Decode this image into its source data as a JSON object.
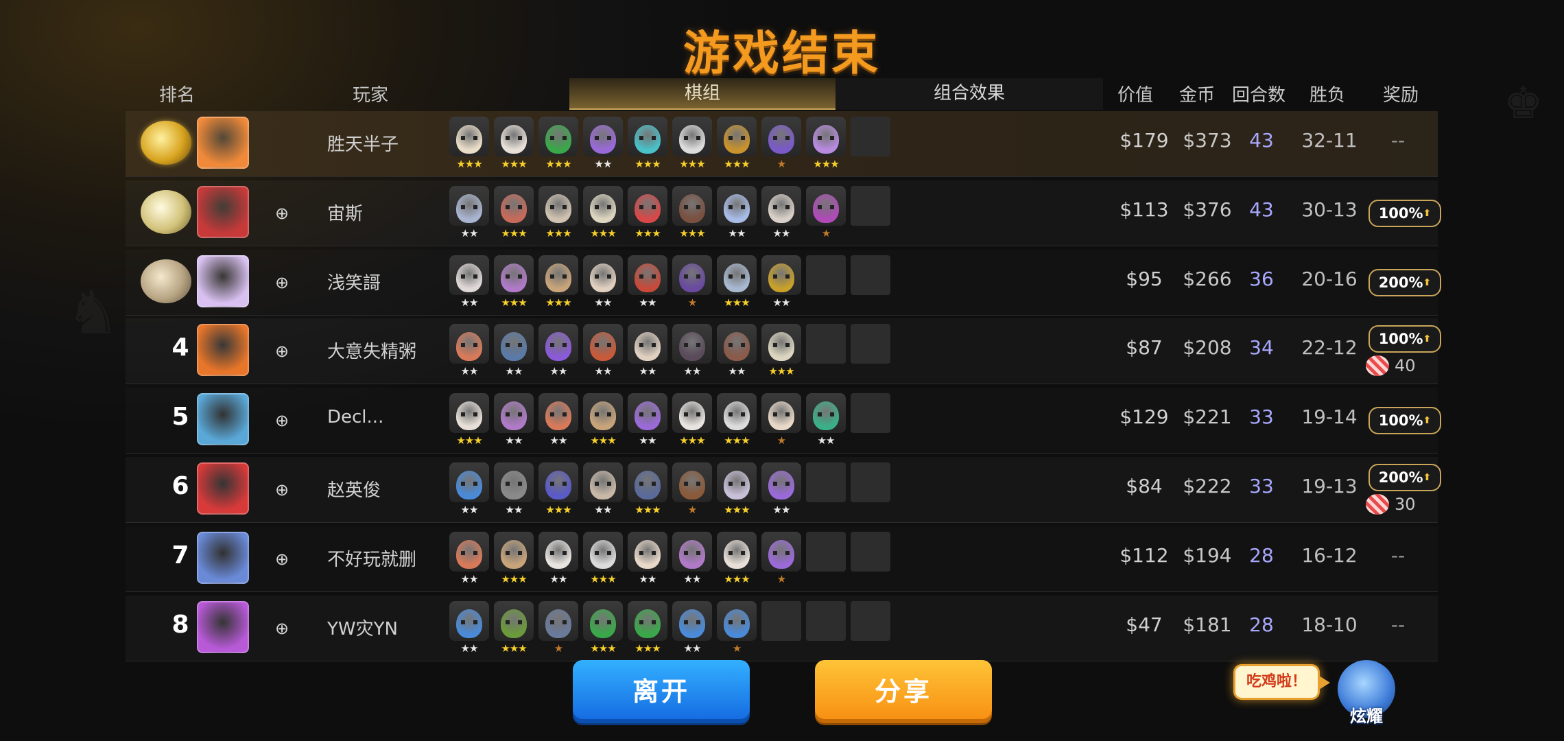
{
  "title": "游戏结束",
  "headers": {
    "rank": "排名",
    "player": "玩家",
    "tab_lineup": "棋组",
    "tab_synergy": "组合效果",
    "value": "价值",
    "gold": "金币",
    "rounds": "回合数",
    "wl": "胜负",
    "reward": "奖励"
  },
  "players": [
    {
      "rank": "1",
      "medal": "gold",
      "name": "胜天半子",
      "value": "$179",
      "gold": "$373",
      "rounds": "43",
      "wl": "32-11",
      "reward": "--",
      "candy": "",
      "add_friend": false,
      "units": [
        {
          "c": "#e9ddc8",
          "s": "★★★",
          "t": "gold"
        },
        {
          "c": "#e8e0d8",
          "s": "★★★",
          "t": "gold"
        },
        {
          "c": "#3aa84a",
          "s": "★★★",
          "t": "gold"
        },
        {
          "c": "#9a6ad8",
          "s": "★★",
          "t": "silver"
        },
        {
          "c": "#4ac0c8",
          "s": "★★★",
          "t": "gold"
        },
        {
          "c": "#dcdcdc",
          "s": "★★★",
          "t": "gold"
        },
        {
          "c": "#c8922c",
          "s": "★★★",
          "t": "gold"
        },
        {
          "c": "#7a5ac8",
          "s": "★",
          "t": "bronze"
        },
        {
          "c": "#b88ae0",
          "s": "★★★",
          "t": "gold"
        }
      ]
    },
    {
      "rank": "2",
      "medal": "silver",
      "name": "宙斯",
      "value": "$113",
      "gold": "$376",
      "rounds": "43",
      "wl": "30-13",
      "reward": "100%",
      "candy": "",
      "add_friend": true,
      "units": [
        {
          "c": "#a9b4d0",
          "s": "★★",
          "t": "silver"
        },
        {
          "c": "#c86a5a",
          "s": "★★★",
          "t": "gold"
        },
        {
          "c": "#cfc2b0",
          "s": "★★★",
          "t": "gold"
        },
        {
          "c": "#dcd6c0",
          "s": "★★★",
          "t": "gold"
        },
        {
          "c": "#d84848",
          "s": "★★★",
          "t": "gold"
        },
        {
          "c": "#7a5040",
          "s": "★★★",
          "t": "gold"
        },
        {
          "c": "#a8bce8",
          "s": "★★",
          "t": "silver"
        },
        {
          "c": "#d8d0c8",
          "s": "★★",
          "t": "silver"
        },
        {
          "c": "#b04ab8",
          "s": "★",
          "t": "bronze"
        }
      ]
    },
    {
      "rank": "3",
      "medal": "bronze",
      "name": "浅笑謌",
      "value": "$95",
      "gold": "$266",
      "rounds": "36",
      "wl": "20-16",
      "reward": "200%",
      "candy": "",
      "add_friend": true,
      "units": [
        {
          "c": "#e0d8d8",
          "s": "★★",
          "t": "silver"
        },
        {
          "c": "#b07ac8",
          "s": "★★★",
          "t": "gold"
        },
        {
          "c": "#c8a47a",
          "s": "★★★",
          "t": "gold"
        },
        {
          "c": "#e0d0c0",
          "s": "★★",
          "t": "silver"
        },
        {
          "c": "#c84a3a",
          "s": "★★",
          "t": "silver"
        },
        {
          "c": "#6a4aa0",
          "s": "★",
          "t": "bronze"
        },
        {
          "c": "#a8b8d0",
          "s": "★★★",
          "t": "gold"
        },
        {
          "c": "#c8a02a",
          "s": "★★",
          "t": "silver"
        }
      ]
    },
    {
      "rank": "4",
      "medal": "",
      "name": "大意失精粥",
      "value": "$87",
      "gold": "$208",
      "rounds": "34",
      "wl": "22-12",
      "reward": "100%",
      "candy": "40",
      "add_friend": true,
      "units": [
        {
          "c": "#d87a5a",
          "s": "★★",
          "t": "silver"
        },
        {
          "c": "#5a7aa8",
          "s": "★★",
          "t": "silver"
        },
        {
          "c": "#8a5ad8",
          "s": "★★",
          "t": "silver"
        },
        {
          "c": "#c85a3a",
          "s": "★★",
          "t": "silver"
        },
        {
          "c": "#e0d0c0",
          "s": "★★",
          "t": "silver"
        },
        {
          "c": "#5a4a5a",
          "s": "★★",
          "t": "silver"
        },
        {
          "c": "#8a5a4a",
          "s": "★★",
          "t": "silver"
        },
        {
          "c": "#dcd6c0",
          "s": "★★★",
          "t": "gold"
        }
      ]
    },
    {
      "rank": "5",
      "medal": "",
      "name": "Decl...",
      "value": "$129",
      "gold": "$221",
      "rounds": "33",
      "wl": "19-14",
      "reward": "100%",
      "candy": "",
      "add_friend": true,
      "units": [
        {
          "c": "#e8e0d8",
          "s": "★★★",
          "t": "gold"
        },
        {
          "c": "#b07ac8",
          "s": "★★",
          "t": "silver"
        },
        {
          "c": "#d87a5a",
          "s": "★★",
          "t": "silver"
        },
        {
          "c": "#c8a47a",
          "s": "★★★",
          "t": "gold"
        },
        {
          "c": "#9a6ad8",
          "s": "★★",
          "t": "silver"
        },
        {
          "c": "#e8e4e0",
          "s": "★★★",
          "t": "gold"
        },
        {
          "c": "#dcdcdc",
          "s": "★★★",
          "t": "gold"
        },
        {
          "c": "#e8d8c8",
          "s": "★",
          "t": "bronze"
        },
        {
          "c": "#3ab088",
          "s": "★★",
          "t": "silver"
        }
      ]
    },
    {
      "rank": "6",
      "medal": "",
      "name": "赵英俊",
      "value": "$84",
      "gold": "$222",
      "rounds": "33",
      "wl": "19-13",
      "reward": "200%",
      "candy": "30",
      "add_friend": true,
      "units": [
        {
          "c": "#4a8ad8",
          "s": "★★",
          "t": "silver"
        },
        {
          "c": "#8a8a8a",
          "s": "★★",
          "t": "silver"
        },
        {
          "c": "#5a5ac8",
          "s": "★★★",
          "t": "gold"
        },
        {
          "c": "#c8b8a8",
          "s": "★★",
          "t": "silver"
        },
        {
          "c": "#5a6a9a",
          "s": "★★★",
          "t": "gold"
        },
        {
          "c": "#8a5a3a",
          "s": "★",
          "t": "bronze"
        },
        {
          "c": "#c8c0d8",
          "s": "★★★",
          "t": "gold"
        },
        {
          "c": "#9a6ad8",
          "s": "★★",
          "t": "silver"
        }
      ]
    },
    {
      "rank": "7",
      "medal": "",
      "name": "不好玩就删",
      "value": "$112",
      "gold": "$194",
      "rounds": "28",
      "wl": "16-12",
      "reward": "--",
      "candy": "",
      "add_friend": true,
      "units": [
        {
          "c": "#d87a5a",
          "s": "★★",
          "t": "silver"
        },
        {
          "c": "#c8a47a",
          "s": "★★★",
          "t": "gold"
        },
        {
          "c": "#e8e4e0",
          "s": "★★",
          "t": "silver"
        },
        {
          "c": "#dcdcdc",
          "s": "★★★",
          "t": "gold"
        },
        {
          "c": "#e8d8c8",
          "s": "★★",
          "t": "silver"
        },
        {
          "c": "#b07ac8",
          "s": "★★",
          "t": "silver"
        },
        {
          "c": "#e8e0d8",
          "s": "★★★",
          "t": "gold"
        },
        {
          "c": "#9a6ad8",
          "s": "★",
          "t": "bronze"
        }
      ]
    },
    {
      "rank": "8",
      "medal": "",
      "name": "YW灾YN",
      "value": "$47",
      "gold": "$181",
      "rounds": "28",
      "wl": "18-10",
      "reward": "--",
      "candy": "",
      "add_friend": true,
      "units": [
        {
          "c": "#4a8ad8",
          "s": "★★",
          "t": "silver"
        },
        {
          "c": "#6a9a3a",
          "s": "★★★",
          "t": "gold"
        },
        {
          "c": "#6a7a9a",
          "s": "★",
          "t": "bronze"
        },
        {
          "c": "#3aa84a",
          "s": "★★★",
          "t": "gold"
        },
        {
          "c": "#3aa84a",
          "s": "★★★",
          "t": "gold"
        },
        {
          "c": "#4a8ad8",
          "s": "★★",
          "t": "silver"
        },
        {
          "c": "#4a8ad8",
          "s": "★",
          "t": "bronze"
        }
      ]
    }
  ],
  "avatars": [
    "#f08a3a",
    "#c83a3a",
    "#d8c0f0",
    "#e8762a",
    "#5aa8d8",
    "#d83a3a",
    "#6a8ad8",
    "#b85ad8"
  ],
  "buttons": {
    "leave": "离开",
    "share": "分享"
  },
  "mascot": {
    "bubble": "吃鸡啦！",
    "label": "炫耀"
  }
}
